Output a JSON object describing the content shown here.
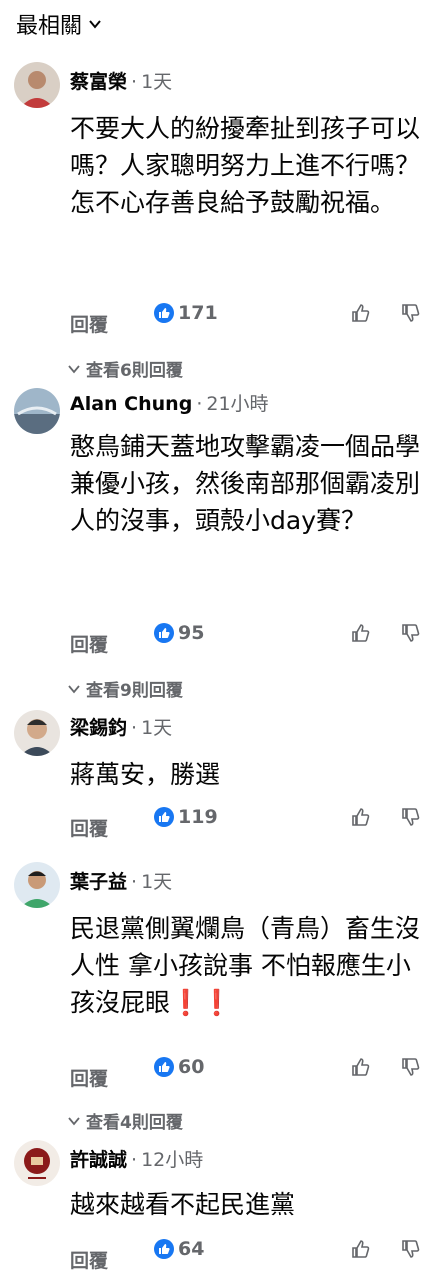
{
  "header": {
    "sort_label": "最相關"
  },
  "comments": [
    {
      "name": "蔡富榮",
      "time": "1天",
      "text": "不要大人的紛擾牽扯到孩子可以嗎？人家聰明努力上進不行嗎？怎不心存善良給予鼓勵祝福。",
      "reply_label": "回覆",
      "likes": "171",
      "more_replies": "查看6則回覆"
    },
    {
      "name": "Alan Chung",
      "time": "21小時",
      "text": "憨鳥鋪天蓋地攻擊霸凌一個品學兼優小孩，然後南部那個霸凌別人的沒事，頭殼小day賽？",
      "reply_label": "回覆",
      "likes": "95",
      "more_replies": "查看9則回覆"
    },
    {
      "name": "梁錫鈞",
      "time": "1天",
      "text": "蔣萬安，勝選",
      "reply_label": "回覆",
      "likes": "119",
      "more_replies": ""
    },
    {
      "name": "葉子益",
      "time": "1天",
      "text": "民退黨側翼爛鳥（青鳥）畜生沒人性 拿小孩說事 不怕報應生小孩沒屁眼❗❗",
      "reply_label": "回覆",
      "likes": "60",
      "more_replies": "查看4則回覆"
    },
    {
      "name": "許誠誠",
      "time": "12小時",
      "text": "越來越看不起民進黨",
      "reply_label": "回覆",
      "likes": "64",
      "more_replies": ""
    }
  ],
  "icons": {
    "like_badge": "thumbs-up-icon",
    "thumb_up": "thumbs-up-outline-icon",
    "thumb_down": "thumbs-down-outline-icon",
    "chevron": "chevron-down-icon"
  },
  "colors": {
    "accent": "#1877f2",
    "meta": "#65676b"
  }
}
